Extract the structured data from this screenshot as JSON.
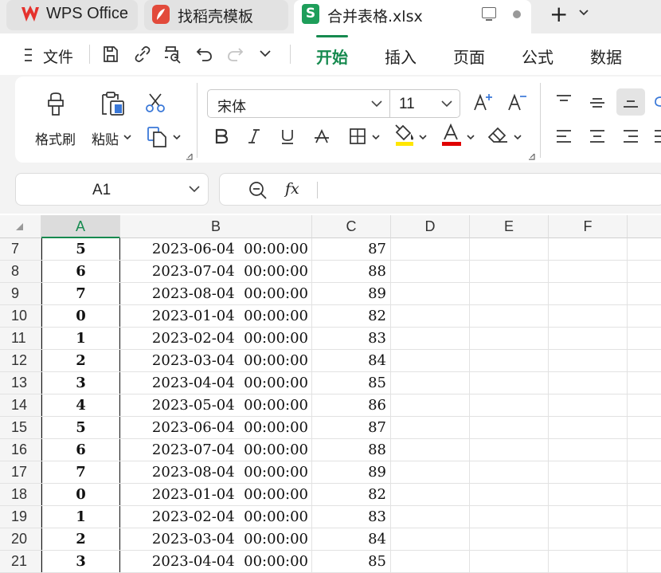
{
  "tabs": [
    {
      "label": "WPS Office"
    },
    {
      "label": "找稻壳模板"
    },
    {
      "label": "合并表格.xlsx"
    }
  ],
  "menubar": {
    "file_label": "文件",
    "ribbon_tabs": [
      "开始",
      "插入",
      "页面",
      "公式",
      "数据"
    ],
    "active_tab": "开始"
  },
  "ribbon": {
    "format_painter_label": "格式刷",
    "paste_label": "粘贴",
    "font_name": "宋体",
    "font_size": "11",
    "font_color": "#e00000",
    "highlight_color": "#ffe600"
  },
  "formula_bar": {
    "cell_ref": "A1",
    "fx_label": "fx",
    "formula_value": ""
  },
  "sheet": {
    "columns": [
      "A",
      "B",
      "C",
      "D",
      "E",
      "F"
    ],
    "selected_column": "A",
    "rows": [
      {
        "num": "7",
        "a": "5",
        "b": "2023-06-04  00:00:00",
        "c": "87"
      },
      {
        "num": "8",
        "a": "6",
        "b": "2023-07-04  00:00:00",
        "c": "88"
      },
      {
        "num": "9",
        "a": "7",
        "b": "2023-08-04  00:00:00",
        "c": "89"
      },
      {
        "num": "10",
        "a": "0",
        "b": "2023-01-04  00:00:00",
        "c": "82"
      },
      {
        "num": "11",
        "a": "1",
        "b": "2023-02-04  00:00:00",
        "c": "83"
      },
      {
        "num": "12",
        "a": "2",
        "b": "2023-03-04  00:00:00",
        "c": "84"
      },
      {
        "num": "13",
        "a": "3",
        "b": "2023-04-04  00:00:00",
        "c": "85"
      },
      {
        "num": "14",
        "a": "4",
        "b": "2023-05-04  00:00:00",
        "c": "86"
      },
      {
        "num": "15",
        "a": "5",
        "b": "2023-06-04  00:00:00",
        "c": "87"
      },
      {
        "num": "16",
        "a": "6",
        "b": "2023-07-04  00:00:00",
        "c": "88"
      },
      {
        "num": "17",
        "a": "7",
        "b": "2023-08-04  00:00:00",
        "c": "89"
      },
      {
        "num": "18",
        "a": "0",
        "b": "2023-01-04  00:00:00",
        "c": "82"
      },
      {
        "num": "19",
        "a": "1",
        "b": "2023-02-04  00:00:00",
        "c": "83"
      },
      {
        "num": "20",
        "a": "2",
        "b": "2023-03-04  00:00:00",
        "c": "84"
      },
      {
        "num": "21",
        "a": "3",
        "b": "2023-04-04  00:00:00",
        "c": "85"
      }
    ]
  }
}
